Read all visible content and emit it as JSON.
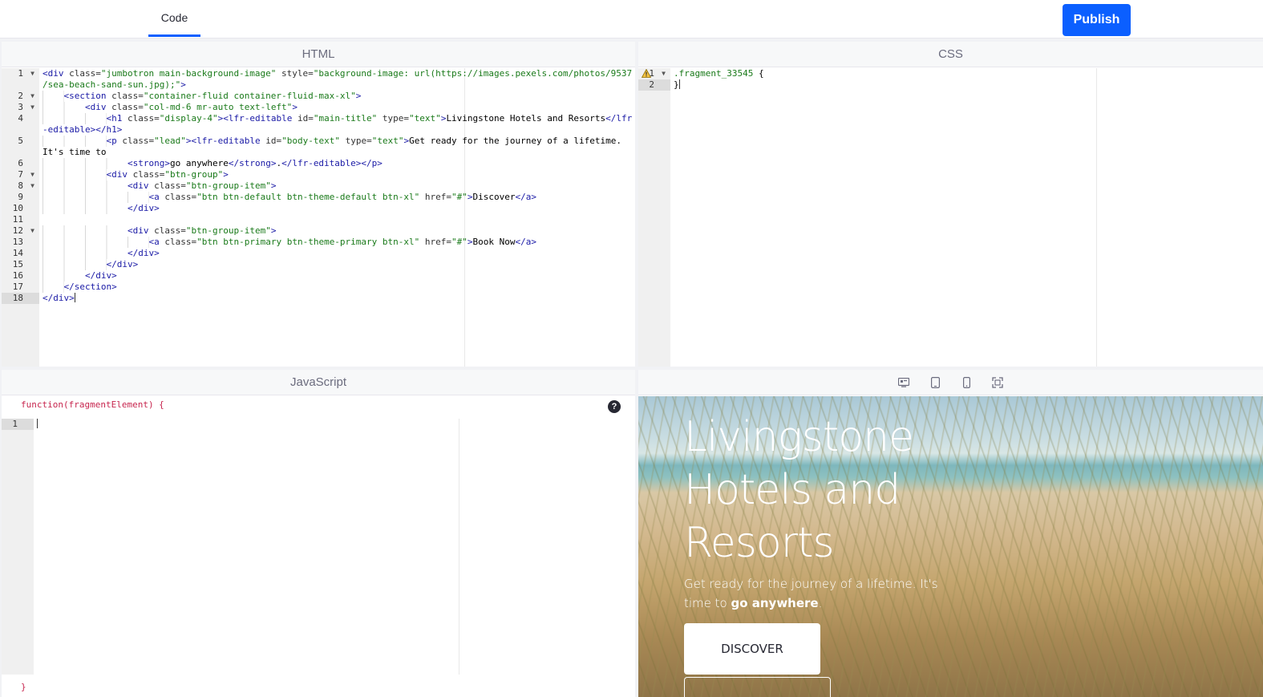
{
  "topbar": {
    "tab_label": "Code",
    "publish_label": "Publish",
    "accent_color": "#0b5fff"
  },
  "html_panel": {
    "title": "HTML",
    "lines": [
      {
        "n": "1",
        "fold": true,
        "segments": [
          [
            "tag",
            "<div "
          ],
          [
            "attr",
            "class="
          ],
          [
            "str",
            "\"jumbotron main-background-image\""
          ],
          [
            "attr",
            " style="
          ],
          [
            "str",
            "\"background-image: url(https://images.pexels.com/photos/9537"
          ]
        ]
      },
      {
        "n": "",
        "fold": false,
        "segments": [
          [
            "str",
            "/sea-beach-sand-sun.jpg);\""
          ],
          [
            "tag",
            ">"
          ]
        ]
      },
      {
        "n": "2",
        "fold": true,
        "indent": 1,
        "segments": [
          [
            "tag",
            "<section "
          ],
          [
            "attr",
            "class="
          ],
          [
            "str",
            "\"container-fluid container-fluid-max-xl\""
          ],
          [
            "tag",
            ">"
          ]
        ]
      },
      {
        "n": "3",
        "fold": true,
        "indent": 2,
        "segments": [
          [
            "tag",
            "<div "
          ],
          [
            "attr",
            "class="
          ],
          [
            "str",
            "\"col-md-6 mr-auto text-left\""
          ],
          [
            "tag",
            ">"
          ]
        ]
      },
      {
        "n": "4",
        "fold": false,
        "indent": 3,
        "segments": [
          [
            "tag",
            "<h1 "
          ],
          [
            "attr",
            "class="
          ],
          [
            "str",
            "\"display-4\""
          ],
          [
            "tag",
            "><lfr-editable "
          ],
          [
            "attr",
            "id="
          ],
          [
            "str",
            "\"main-title\""
          ],
          [
            "attr",
            " type="
          ],
          [
            "str",
            "\"text\""
          ],
          [
            "tag",
            ">"
          ],
          [
            "txt",
            "Livingstone Hotels and Resorts"
          ],
          [
            "tag",
            "</lfr"
          ]
        ]
      },
      {
        "n": "",
        "fold": false,
        "segments": [
          [
            "tag",
            "-editable></h1>"
          ]
        ]
      },
      {
        "n": "5",
        "fold": false,
        "indent": 3,
        "segments": [
          [
            "tag",
            "<p "
          ],
          [
            "attr",
            "class="
          ],
          [
            "str",
            "\"lead\""
          ],
          [
            "tag",
            "><lfr-editable "
          ],
          [
            "attr",
            "id="
          ],
          [
            "str",
            "\"body-text\""
          ],
          [
            "attr",
            " type="
          ],
          [
            "str",
            "\"text\""
          ],
          [
            "tag",
            ">"
          ],
          [
            "txt",
            "Get ready for the journey of a lifetime."
          ]
        ]
      },
      {
        "n": "",
        "fold": false,
        "segments": [
          [
            "txt",
            "It's time to"
          ]
        ]
      },
      {
        "n": "6",
        "fold": false,
        "indent": 4,
        "segments": [
          [
            "tag",
            "<strong>"
          ],
          [
            "txt",
            "go anywhere"
          ],
          [
            "tag",
            "</strong>"
          ],
          [
            "txt",
            "."
          ],
          [
            "tag",
            "</lfr-editable></p>"
          ]
        ]
      },
      {
        "n": "7",
        "fold": true,
        "indent": 3,
        "segments": [
          [
            "tag",
            "<div "
          ],
          [
            "attr",
            "class="
          ],
          [
            "str",
            "\"btn-group\""
          ],
          [
            "tag",
            ">"
          ]
        ]
      },
      {
        "n": "8",
        "fold": true,
        "indent": 4,
        "segments": [
          [
            "tag",
            "<div "
          ],
          [
            "attr",
            "class="
          ],
          [
            "str",
            "\"btn-group-item\""
          ],
          [
            "tag",
            ">"
          ]
        ]
      },
      {
        "n": "9",
        "fold": false,
        "indent": 5,
        "segments": [
          [
            "tag",
            "<a "
          ],
          [
            "attr",
            "class="
          ],
          [
            "str",
            "\"btn btn-default btn-theme-default btn-xl\""
          ],
          [
            "attr",
            " href="
          ],
          [
            "str",
            "\"#\""
          ],
          [
            "tag",
            ">"
          ],
          [
            "txt",
            "Discover"
          ],
          [
            "tag",
            "</a>"
          ]
        ]
      },
      {
        "n": "10",
        "fold": false,
        "indent": 4,
        "segments": [
          [
            "tag",
            "</div>"
          ]
        ]
      },
      {
        "n": "11",
        "fold": false,
        "segments": []
      },
      {
        "n": "12",
        "fold": true,
        "indent": 4,
        "segments": [
          [
            "tag",
            "<div "
          ],
          [
            "attr",
            "class="
          ],
          [
            "str",
            "\"btn-group-item\""
          ],
          [
            "tag",
            ">"
          ]
        ]
      },
      {
        "n": "13",
        "fold": false,
        "indent": 5,
        "segments": [
          [
            "tag",
            "<a "
          ],
          [
            "attr",
            "class="
          ],
          [
            "str",
            "\"btn btn-primary btn-theme-primary btn-xl\""
          ],
          [
            "attr",
            " href="
          ],
          [
            "str",
            "\"#\""
          ],
          [
            "tag",
            ">"
          ],
          [
            "txt",
            "Book Now"
          ],
          [
            "tag",
            "</a>"
          ]
        ]
      },
      {
        "n": "14",
        "fold": false,
        "indent": 4,
        "segments": [
          [
            "tag",
            "</div>"
          ]
        ]
      },
      {
        "n": "15",
        "fold": false,
        "indent": 3,
        "segments": [
          [
            "tag",
            "</div>"
          ]
        ]
      },
      {
        "n": "16",
        "fold": false,
        "indent": 2,
        "segments": [
          [
            "tag",
            "</div>"
          ]
        ]
      },
      {
        "n": "17",
        "fold": false,
        "indent": 1,
        "segments": [
          [
            "tag",
            "</section>"
          ]
        ]
      },
      {
        "n": "18",
        "fold": false,
        "active": true,
        "cursor": true,
        "segments": [
          [
            "tag",
            "</div>"
          ]
        ]
      }
    ]
  },
  "css_panel": {
    "title": "CSS",
    "lines": [
      {
        "n": "1",
        "fold": true,
        "warning": true,
        "segments": [
          [
            "str",
            ".fragment_33545"
          ],
          [
            "txt",
            " {"
          ]
        ]
      },
      {
        "n": "2",
        "fold": false,
        "active": true,
        "cursor": true,
        "segments": [
          [
            "txt",
            "}"
          ]
        ]
      }
    ]
  },
  "js_panel": {
    "title": "JavaScript",
    "signature": "function(fragmentElement) {",
    "closing": "}",
    "help_label": "?",
    "lines": [
      {
        "n": "1",
        "active": true,
        "cursor": true,
        "segments": []
      }
    ]
  },
  "preview": {
    "title": "Livingstone Hotels and Resorts",
    "lead_prefix": "Get ready for the journey of a lifetime. It's time to ",
    "lead_strong": "go anywhere",
    "lead_suffix": ".",
    "discover_label": "DISCOVER",
    "toolbar_icons": [
      "desktop-icon",
      "tablet-icon",
      "mobile-icon",
      "custom-size-icon"
    ]
  }
}
